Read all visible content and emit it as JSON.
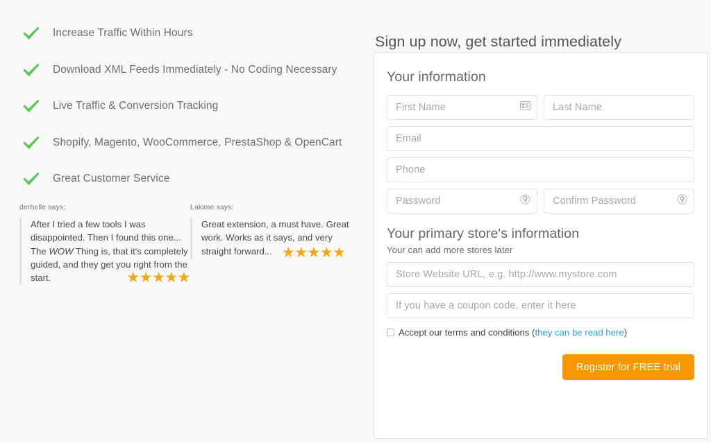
{
  "benefits": {
    "icon": "check-icon",
    "items": [
      {
        "label": "Increase Traffic Within Hours"
      },
      {
        "label": "Download XML Feeds Immediately - No Coding Necessary"
      },
      {
        "label": "Live Traffic & Conversion Tracking"
      },
      {
        "label": "Shopify, Magento, WooCommerce, PrestaShop & OpenCart"
      },
      {
        "label": "Great Customer Service"
      }
    ]
  },
  "testimonials": [
    {
      "author": "derhelle says:",
      "quote_part1": "After I tried a few tools I was disappointed. Then I found this one... The ",
      "quote_emphasis": "WOW",
      "quote_part2": " Thing is, that it's completely guided, and they get you right from the start.",
      "stars": "★★★★★",
      "rating": 5
    },
    {
      "author": "Lakime says:",
      "quote": "Great extension, a must have. Great work. Works as it says, and very straight forward...",
      "stars": "★★★★★",
      "rating": 5
    }
  ],
  "signup": {
    "title": "Sign up now, get started immediately",
    "your_information": {
      "heading": "Your information",
      "first_name_placeholder": "First Name",
      "first_name_value": "",
      "first_name_icon": "contact-card-icon",
      "last_name_placeholder": "Last Name",
      "last_name_value": "",
      "email_placeholder": "Email",
      "email_value": "",
      "phone_placeholder": "Phone",
      "phone_value": "",
      "password_placeholder": "Password",
      "password_value": "",
      "password_icon": "key-icon",
      "confirm_password_placeholder": "Confirm Password",
      "confirm_password_value": "",
      "confirm_password_icon": "key-icon"
    },
    "store_information": {
      "heading": "Your primary store's information",
      "subtext": "Your can add more stores later",
      "store_url_placeholder": "Store Website URL, e.g. http://www.mystore.com",
      "store_url_value": "",
      "coupon_placeholder": "If you have a coupon code, enter it here",
      "coupon_value": ""
    },
    "terms": {
      "checked": false,
      "text_before": "Accept our terms and conditions (",
      "link_text": "they can be read here",
      "text_after": ")"
    },
    "submit_label": "Register for FREE trial"
  },
  "colors": {
    "page_background": "#f8f8f8",
    "check_green": "#5cc65c",
    "star_gold": "#f0a818",
    "button_orange": "#f99703",
    "link_blue": "#2e9fd4",
    "card_border": "#e3e3e3",
    "input_border": "#e0e0e0",
    "placeholder_text": "#a8a8a8"
  }
}
